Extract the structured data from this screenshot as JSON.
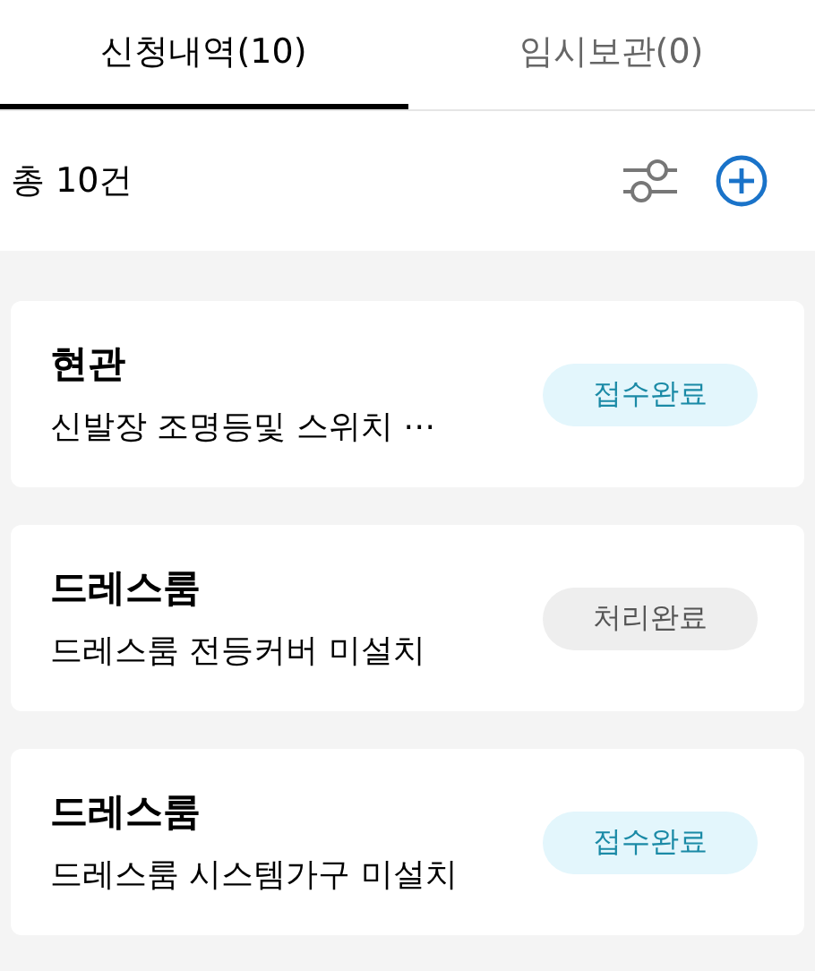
{
  "tabs": [
    {
      "label": "신청내역(10)",
      "selected": true
    },
    {
      "label": "임시보관(0)",
      "selected": false
    }
  ],
  "summary": {
    "total": "총 10건"
  },
  "requests": [
    {
      "title": "현관",
      "description": "신발장 조명등및 스위치 ⋯",
      "status": "접수완료",
      "kind": "received"
    },
    {
      "title": "드레스룸",
      "description": "드레스룸 전등커버 미설치",
      "status": "처리완료",
      "kind": "done"
    },
    {
      "title": "드레스룸",
      "description": "드레스룸 시스템가구 미설치",
      "status": "접수완료",
      "kind": "received"
    }
  ]
}
